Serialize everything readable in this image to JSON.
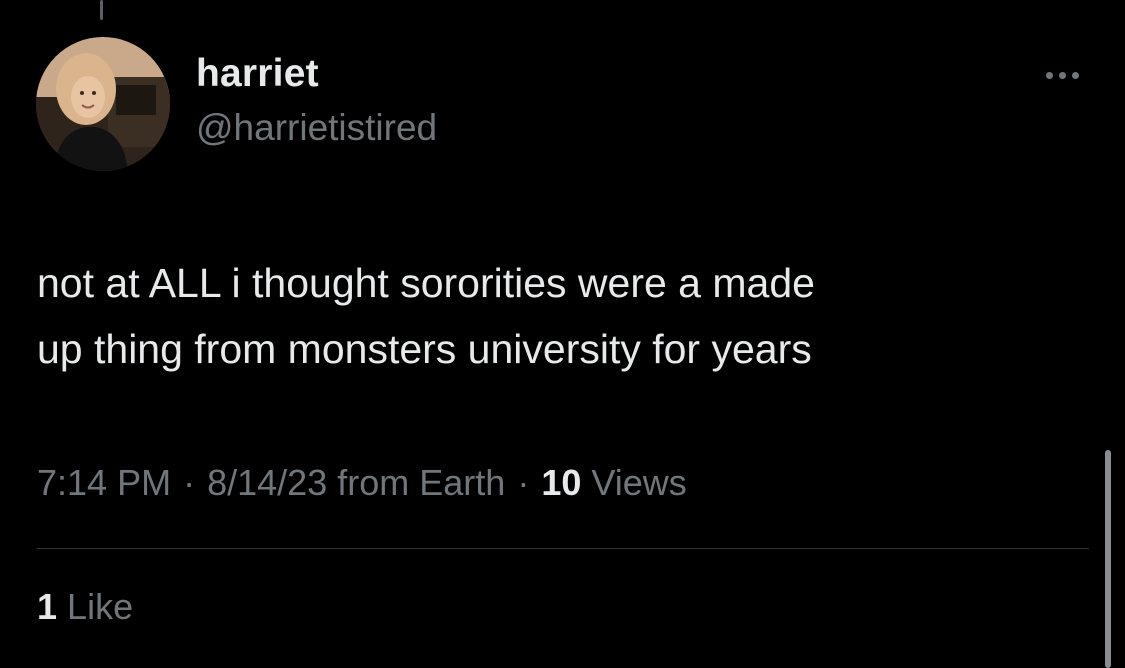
{
  "tweet": {
    "author": {
      "display_name": "harriet",
      "handle": "@harrietistired"
    },
    "text": "not at ALL i thought sororities were a made\nup thing from monsters university for years",
    "meta": {
      "time": "7:14 PM",
      "separator": "·",
      "date": "8/14/23",
      "source": "from Earth",
      "views_count": "10",
      "views_label": "Views"
    },
    "likes": {
      "count": "1",
      "label": "Like"
    }
  },
  "icons": {
    "more": "more-horizontal-icon"
  },
  "colors": {
    "background": "#000000",
    "primary_text": "#e7e9ea",
    "secondary_text": "#71767b",
    "divider": "#2f3336"
  }
}
